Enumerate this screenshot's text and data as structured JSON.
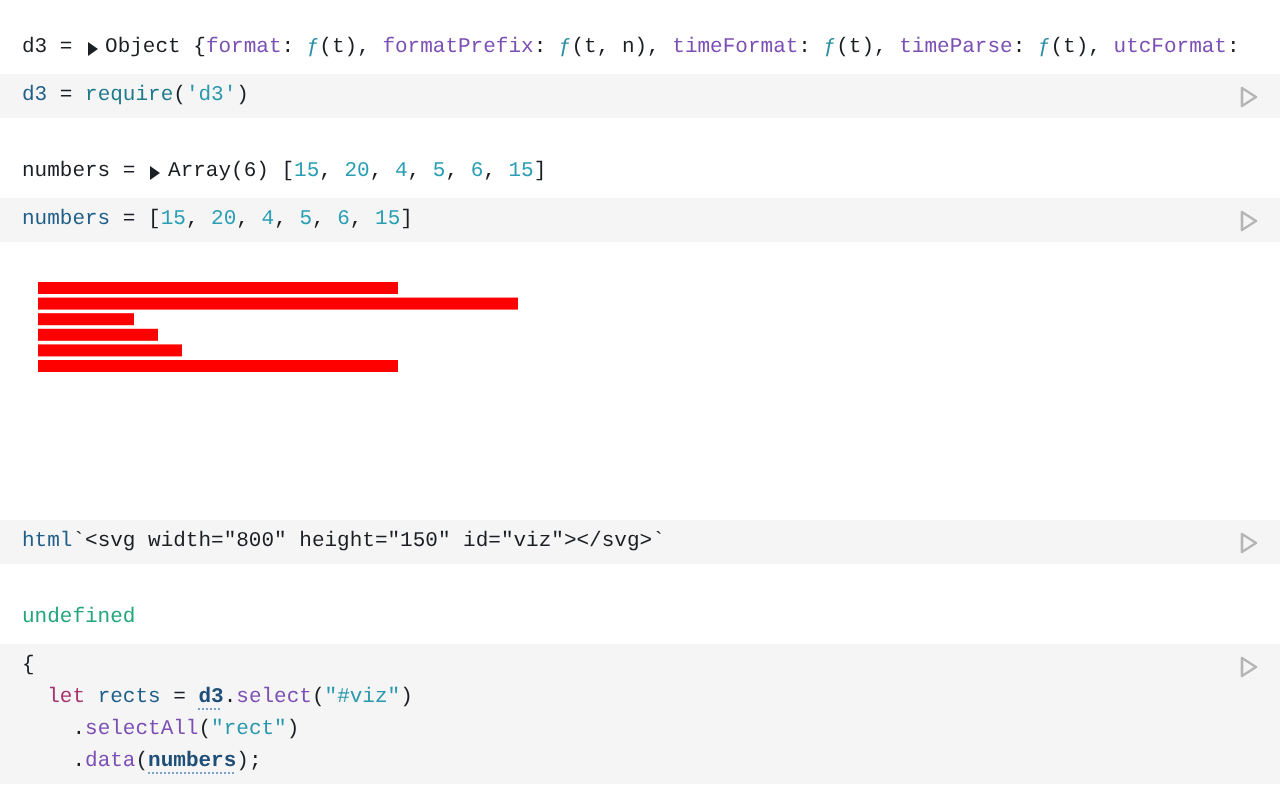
{
  "cells": [
    {
      "output": {
        "kind": "inspector",
        "tokens": [
          {
            "t": "d3 = ",
            "kind": "plain"
          },
          {
            "kind": "toggle"
          },
          {
            "t": "Object {",
            "kind": "plain"
          },
          {
            "t": "format",
            "kind": "prop"
          },
          {
            "t": ": ",
            "kind": "plain"
          },
          {
            "t": "ƒ",
            "kind": "fn"
          },
          {
            "t": "(t), ",
            "kind": "plain"
          },
          {
            "t": "formatPrefix",
            "kind": "prop"
          },
          {
            "t": ": ",
            "kind": "plain"
          },
          {
            "t": "ƒ",
            "kind": "fn"
          },
          {
            "t": "(t, n), ",
            "kind": "plain"
          },
          {
            "t": "timeFormat",
            "kind": "prop"
          },
          {
            "t": ": ",
            "kind": "plain"
          },
          {
            "t": "ƒ",
            "kind": "fn"
          },
          {
            "t": "(t), ",
            "kind": "plain"
          },
          {
            "t": "timeParse",
            "kind": "prop"
          },
          {
            "t": ": ",
            "kind": "plain"
          },
          {
            "t": "ƒ",
            "kind": "fn"
          },
          {
            "t": "(t), ",
            "kind": "plain"
          },
          {
            "t": "utcFormat",
            "kind": "prop"
          },
          {
            "t": ":",
            "kind": "plain"
          }
        ]
      },
      "code_lines": [
        [
          {
            "t": "d3",
            "kind": "def"
          },
          {
            "t": " = ",
            "kind": "plain"
          },
          {
            "t": "require",
            "kind": "call"
          },
          {
            "t": "(",
            "kind": "plain"
          },
          {
            "t": "'d3'",
            "kind": "string"
          },
          {
            "t": ")",
            "kind": "plain"
          }
        ]
      ]
    },
    {
      "output": {
        "kind": "inspector",
        "tokens": [
          {
            "t": "numbers = ",
            "kind": "plain"
          },
          {
            "kind": "toggle"
          },
          {
            "t": "Array(6) [",
            "kind": "plain"
          },
          {
            "t": "15",
            "kind": "number"
          },
          {
            "t": ", ",
            "kind": "plain"
          },
          {
            "t": "20",
            "kind": "number"
          },
          {
            "t": ", ",
            "kind": "plain"
          },
          {
            "t": "4",
            "kind": "number"
          },
          {
            "t": ", ",
            "kind": "plain"
          },
          {
            "t": "5",
            "kind": "number"
          },
          {
            "t": ", ",
            "kind": "plain"
          },
          {
            "t": "6",
            "kind": "number"
          },
          {
            "t": ", ",
            "kind": "plain"
          },
          {
            "t": "15",
            "kind": "number"
          },
          {
            "t": "]",
            "kind": "plain"
          }
        ]
      },
      "code_lines": [
        [
          {
            "t": "numbers",
            "kind": "def"
          },
          {
            "t": " = [",
            "kind": "plain"
          },
          {
            "t": "15",
            "kind": "number"
          },
          {
            "t": ", ",
            "kind": "plain"
          },
          {
            "t": "20",
            "kind": "number"
          },
          {
            "t": ", ",
            "kind": "plain"
          },
          {
            "t": "4",
            "kind": "number"
          },
          {
            "t": ", ",
            "kind": "plain"
          },
          {
            "t": "5",
            "kind": "number"
          },
          {
            "t": ", ",
            "kind": "plain"
          },
          {
            "t": "6",
            "kind": "number"
          },
          {
            "t": ", ",
            "kind": "plain"
          },
          {
            "t": "15",
            "kind": "number"
          },
          {
            "t": "]",
            "kind": "plain"
          }
        ]
      ]
    },
    {
      "output": {
        "kind": "chart"
      },
      "code_lines": [
        [
          {
            "t": "html",
            "kind": "def"
          },
          {
            "t": "`<svg width=\"800\" height=\"150\" id=\"viz\"></svg>`",
            "kind": "plain"
          }
        ]
      ]
    },
    {
      "output": {
        "kind": "value",
        "tokens": [
          {
            "t": "undefined",
            "kind": "undefined"
          }
        ]
      },
      "code_lines": [
        [
          {
            "t": "{",
            "kind": "plain"
          }
        ],
        [
          {
            "t": "  let",
            "kind": "keyword"
          },
          {
            "t": " rects",
            "kind": "def"
          },
          {
            "t": " = ",
            "kind": "plain"
          },
          {
            "t": "d3",
            "kind": "ref"
          },
          {
            "t": ".",
            "kind": "plain"
          },
          {
            "t": "select",
            "kind": "prop"
          },
          {
            "t": "(",
            "kind": "plain"
          },
          {
            "t": "\"#viz\"",
            "kind": "string"
          },
          {
            "t": ")",
            "kind": "plain"
          }
        ],
        [
          {
            "t": "    .",
            "kind": "plain"
          },
          {
            "t": "selectAll",
            "kind": "prop"
          },
          {
            "t": "(",
            "kind": "plain"
          },
          {
            "t": "\"rect\"",
            "kind": "string"
          },
          {
            "t": ")",
            "kind": "plain"
          }
        ],
        [
          {
            "t": "    .",
            "kind": "plain"
          },
          {
            "t": "data",
            "kind": "prop"
          },
          {
            "t": "(",
            "kind": "plain"
          },
          {
            "t": "numbers",
            "kind": "ref"
          },
          {
            "t": ");",
            "kind": "plain"
          }
        ]
      ]
    }
  ]
}
